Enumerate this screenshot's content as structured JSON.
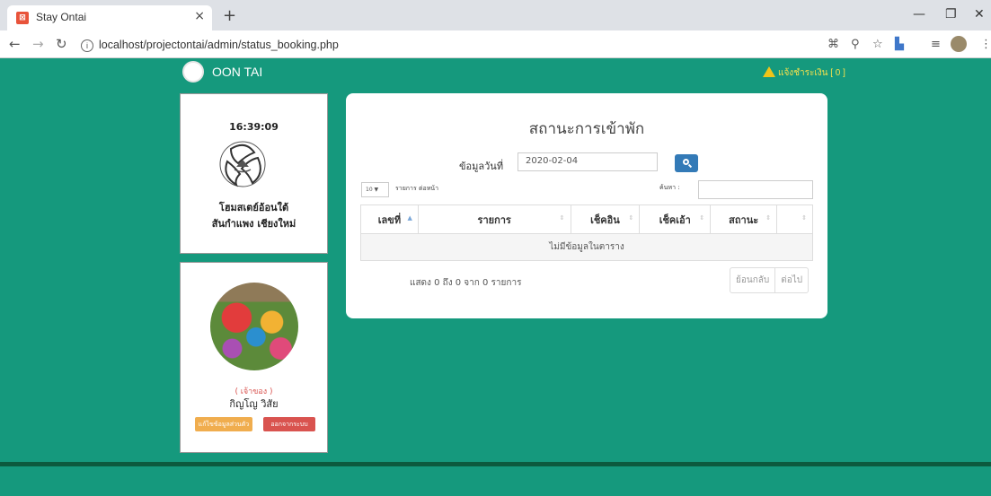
{
  "browser": {
    "tab_title": "Stay Ontai",
    "tab_close": "×",
    "new_tab": "+",
    "url": "localhost/projectontai/admin/status_booking.php"
  },
  "header": {
    "brand": "OON TAI",
    "notify": "แจ้งชำระเงิน [ 0 ]"
  },
  "left_panel": {
    "clock": "16:39:09",
    "home_name": "โฮมสเตย์อ้อนใต้",
    "home_location": "สันกำแพง เชียงใหม่"
  },
  "profile": {
    "role": "( เจ้าของ )",
    "name": "กิญโญ วิสัย",
    "edit_button": "แก้ไขข้อมูลส่วนตัว",
    "logout_button": "ออกจากระบบ"
  },
  "main": {
    "title": "สถานะการเข้าพัก",
    "date_label": "ข้อมูลวันที่",
    "date_value": "2020-02-04",
    "length_value": "10",
    "length_label": "รายการ ต่อหน้า",
    "search_label": "ค้นหา :",
    "columns": [
      "เลขที่",
      "รายการ",
      "เช็คอิน",
      "เช็คเอ้า",
      "สถานะ",
      ""
    ],
    "empty_message": "ไม่มีข้อมูลในตาราง",
    "info": "แสดง 0 ถึง 0 จาก 0 รายการ",
    "prev": "ย้อนกลับ",
    "next": "ต่อไป"
  }
}
